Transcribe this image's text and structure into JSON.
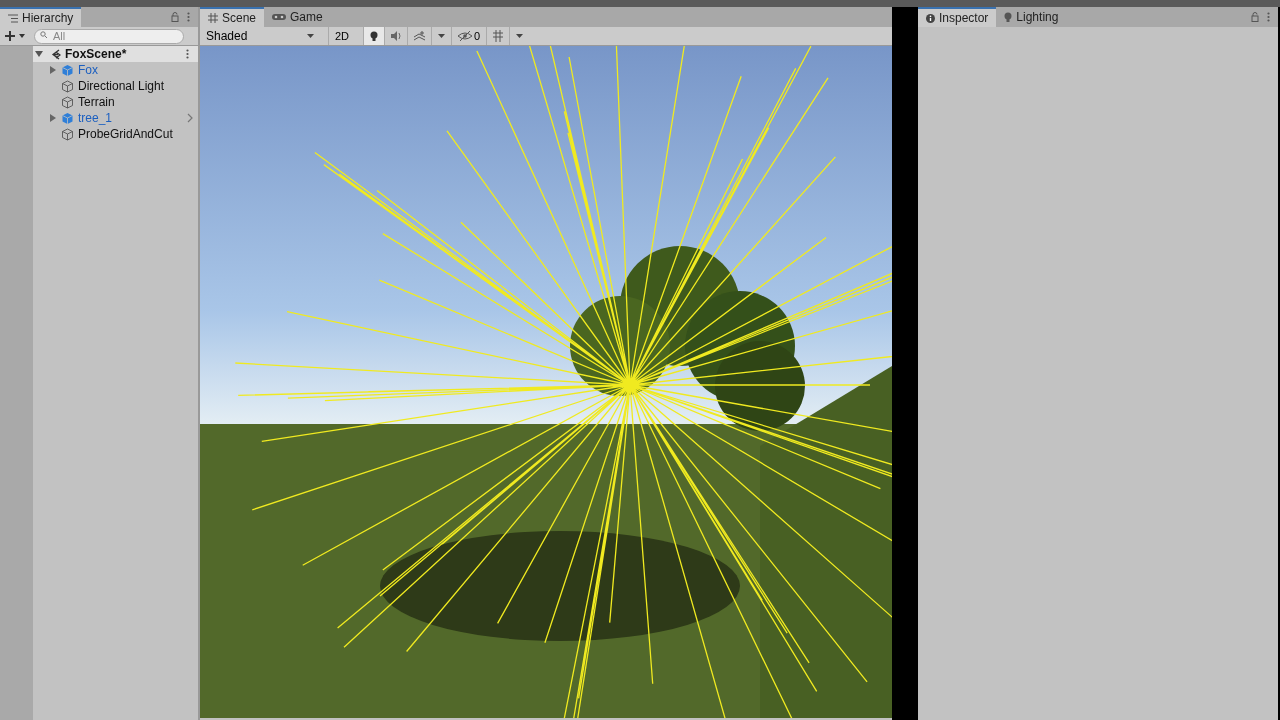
{
  "hierarchy": {
    "title": "Hierarchy",
    "selected": true,
    "search": {
      "placeholder": "All"
    },
    "scene": {
      "name": "FoxScene*",
      "expanded": true,
      "children": [
        {
          "name": "Fox",
          "kind": "prefab",
          "expandable": true,
          "override_arrow": false
        },
        {
          "name": "Directional Light",
          "kind": "object",
          "expandable": false,
          "override_arrow": false
        },
        {
          "name": "Terrain",
          "kind": "object",
          "expandable": false,
          "override_arrow": false
        },
        {
          "name": "tree_1",
          "kind": "prefab",
          "expandable": true,
          "override_arrow": true
        },
        {
          "name": "ProbeGridAndCut",
          "kind": "object",
          "expandable": false,
          "override_arrow": false
        }
      ]
    }
  },
  "scene_tabs": [
    {
      "label": "Scene",
      "kind": "scene",
      "selected": true
    },
    {
      "label": "Game",
      "kind": "game",
      "selected": false
    }
  ],
  "scene_toolbar": {
    "shading": "Shaded",
    "mode_2d": "2D",
    "lighting_on": true,
    "hidden_count": "0"
  },
  "inspector_tabs": [
    {
      "label": "Inspector",
      "kind": "info",
      "selected": true
    },
    {
      "label": "Lighting",
      "kind": "bulb",
      "selected": false
    }
  ]
}
